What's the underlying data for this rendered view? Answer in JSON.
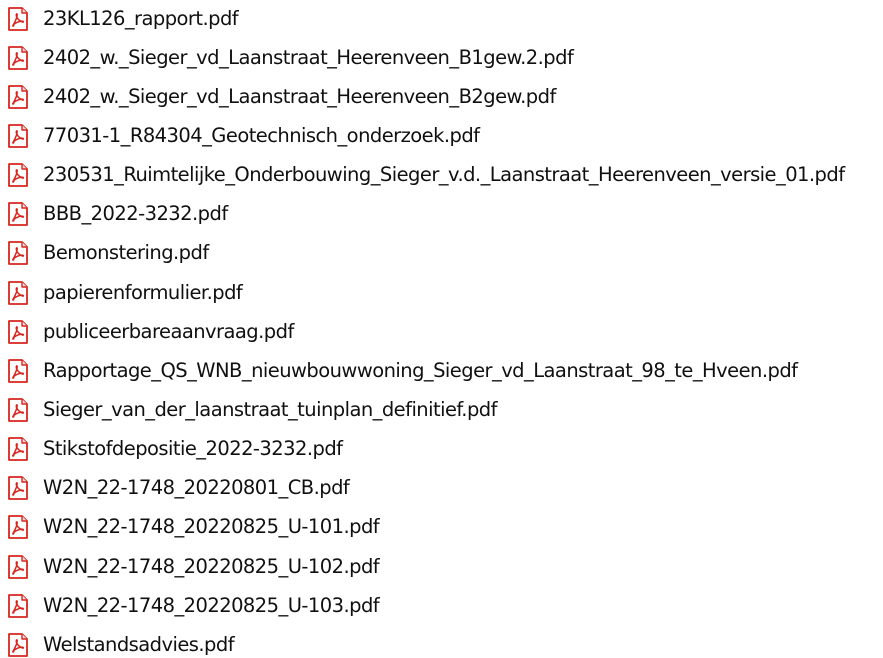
{
  "file_list": {
    "icon": "pdf-file-icon",
    "accent_color": "#d7261e",
    "items": [
      {
        "name": "23KL126_rapport.pdf"
      },
      {
        "name": "2402_w._Sieger_vd_Laanstraat_Heerenveen_B1gew.2.pdf"
      },
      {
        "name": "2402_w._Sieger_vd_Laanstraat_Heerenveen_B2gew.pdf"
      },
      {
        "name": "77031-1_R84304_Geotechnisch_onderzoek.pdf"
      },
      {
        "name": "230531_Ruimtelijke_Onderbouwing_Sieger_v.d._Laanstraat_Heerenveen_versie_01.pdf"
      },
      {
        "name": "BBB_2022-3232.pdf"
      },
      {
        "name": "Bemonstering.pdf"
      },
      {
        "name": "papierenformulier.pdf"
      },
      {
        "name": "publiceerbareaanvraag.pdf"
      },
      {
        "name": "Rapportage_QS_WNB_nieuwbouwwoning_Sieger_vd_Laanstraat_98_te_Hveen.pdf"
      },
      {
        "name": "Sieger_van_der_laanstraat_tuinplan_definitief.pdf"
      },
      {
        "name": "Stikstofdepositie_2022-3232.pdf"
      },
      {
        "name": "W2N_22-1748_20220801_CB.pdf"
      },
      {
        "name": "W2N_22-1748_20220825_U-101.pdf"
      },
      {
        "name": "W2N_22-1748_20220825_U-102.pdf"
      },
      {
        "name": "W2N_22-1748_20220825_U-103.pdf"
      },
      {
        "name": "Welstandsadvies.pdf"
      }
    ]
  }
}
